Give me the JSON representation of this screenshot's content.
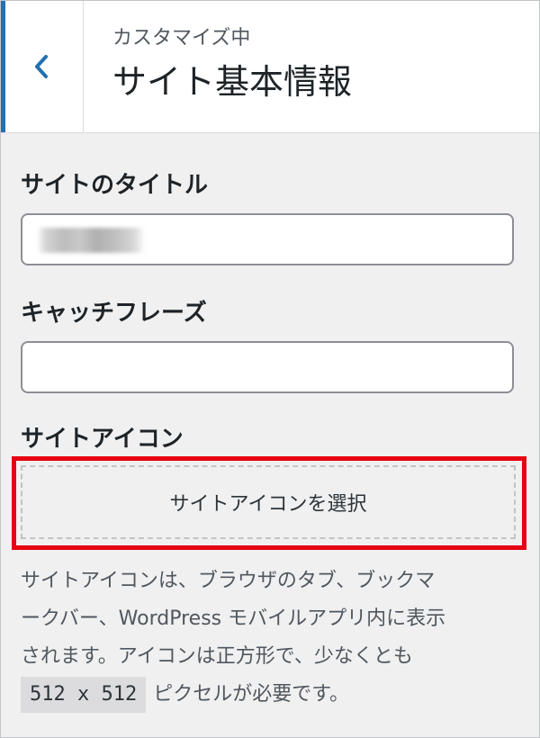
{
  "header": {
    "back_icon": "chevron-left-icon",
    "customizing_label": "カスタマイズ中",
    "section_title": "サイト基本情報"
  },
  "fields": {
    "site_title": {
      "label": "サイトのタイトル",
      "value": ""
    },
    "tagline": {
      "label": "キャッチフレーズ",
      "value": ""
    },
    "site_icon": {
      "label": "サイトアイコン",
      "button_label": "サイトアイコンを選択",
      "description_lines": [
        "サイトアイコンは、ブラウザのタブ、ブックマ",
        "ークバー、WordPress モバイルアプリ内に表示",
        "されます。アイコンは正方形で、少なくとも"
      ],
      "size_code": "512 x 512",
      "description_tail": "ピクセルが必要です。"
    }
  },
  "colors": {
    "accent": "#2271b1",
    "highlight": "#e60012",
    "background": "#f0f0f1"
  }
}
